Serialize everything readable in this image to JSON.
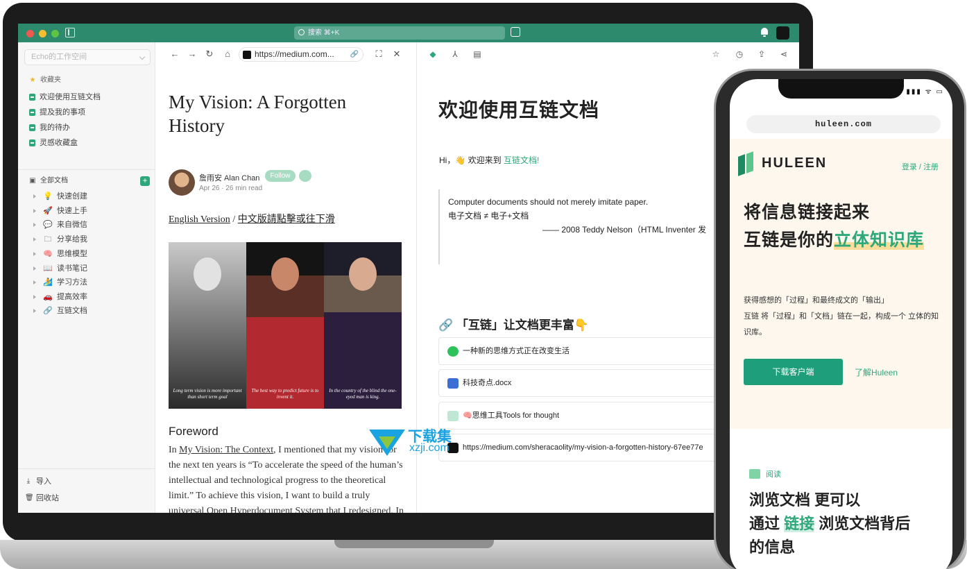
{
  "titlebar": {
    "search_text": "搜索 ⌘+K"
  },
  "nav": {
    "workspace": "Echo的工作空间",
    "favorites_label": "收藏夹",
    "favorites": [
      "欢迎使用互链文档",
      "提及我的事项",
      "我的待办",
      "灵感收藏盒"
    ],
    "all_docs_label": "全部文档",
    "tree": [
      {
        "emoji": "💡",
        "label": "快速创建"
      },
      {
        "emoji": "🚀",
        "label": "快速上手"
      },
      {
        "emoji": "💬",
        "label": "来自微信"
      },
      {
        "emoji": "🗀",
        "label": "分享给我"
      },
      {
        "emoji": "🧠",
        "label": "思维模型"
      },
      {
        "emoji": "📖",
        "label": "读书笔记"
      },
      {
        "emoji": "🏄",
        "label": "学习方法"
      },
      {
        "emoji": "🚗",
        "label": "提高效率"
      },
      {
        "emoji": "🔗",
        "label": "互链文档"
      }
    ],
    "import_label": "导入",
    "trash_label": "回收站"
  },
  "web": {
    "url": "https://medium.com...",
    "article_title": "My Vision: A Forgotten History",
    "author": "詹雨安 Alan Chan",
    "follow_label": "Follow",
    "meta": "Apr 26 · 26 min read",
    "lang_en": "English Version",
    "lang_sep": " / ",
    "lang_zh": "中文版請點擊或往下滑",
    "photo_captions": [
      "Long term vision is more important than short term goal",
      "The best way to predict future is to invent it.",
      "In the country of the blind the one-eyed man is king."
    ],
    "section_heading": "Foreword",
    "body_pre": "In ",
    "body_link": "My Vision: The Context",
    "body_post": ", I mentioned that my vision for the next ten years is “To accelerate the speed of the human’s intellectual and technological progress to the theoretical limit.” To achieve this vision, I want to build a truly universal Open Hyperdocument System that I redesigned. In My"
  },
  "doc": {
    "title": "欢迎使用互链文档",
    "hi_prefix": "Hi，👋 欢迎来到",
    "hi_link": "互链文档!",
    "quote_line1": "Computer documents should not merely imitate paper.",
    "quote_line2": "电子文档 ≠ 电子+文档",
    "quote_line3": "—— 2008 Teddy Nelson（HTML Inventer 发",
    "rich_heading": "🔗 「互链」让文档更丰富👇",
    "cards": [
      "一种新的思维方式正在改变生活",
      "科技奇点.docx",
      "🧠思维工具Tools for thought",
      "https://medium.com/sheracaolity/my-vision-a-forgotten-history-67ee77e"
    ]
  },
  "phone": {
    "status": "▮▮▮ ᯤ ▭",
    "url": "huleen.com",
    "brand": "HULEEN",
    "login": "登录 / 注册",
    "hero_line1": "将信息链接起来",
    "hero_line2_pre": "互链是你的",
    "hero_line2_hl": "立体知识库",
    "desc_line1": "获得感想的「过程」和最终成文的「输出」",
    "desc_line2": "互链 将「过程」和「文档」链在一起，构成一个 立体的知识库。",
    "download_label": "下载客户端",
    "learn_label": "了解Huleen",
    "read_tag": "阅读",
    "read_line1": "浏览文档 更可以",
    "read_line2_pre": "通过 ",
    "read_line2_hl": "链接",
    "read_line2_post": " 浏览文档背后",
    "read_line3": "的信息"
  },
  "watermark": {
    "title": "下载集",
    "domain": "xzji.com"
  },
  "colors": {
    "accent": "#2ea77a",
    "titlebar": "#2d8a6c"
  }
}
